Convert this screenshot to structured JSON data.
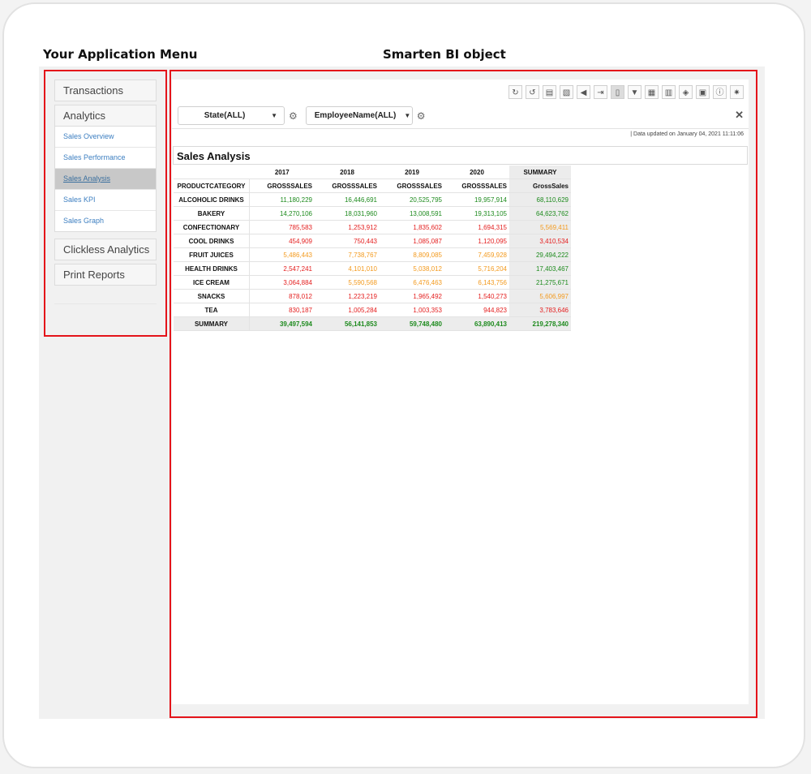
{
  "captions": {
    "menu": "Your Application Menu",
    "bi": "Smarten BI object"
  },
  "menu": {
    "transactions": "Transactions",
    "analytics": {
      "label": "Analytics",
      "items": [
        "Sales Overview",
        "Sales Performance",
        "Sales Analysis",
        "Sales KPI",
        "Sales Graph"
      ]
    },
    "clickless": "Clickless Analytics",
    "print": "Print Reports"
  },
  "toolbar_icons": [
    "refresh-icon",
    "reset-icon",
    "save-icon",
    "save-as-icon",
    "announce-icon",
    "export-icon",
    "new-doc-icon",
    "filter-icon",
    "calculator-icon",
    "grid-icon",
    "cube-icon",
    "print-icon",
    "info-icon",
    "settings-icon"
  ],
  "filters": {
    "state": "State(ALL)",
    "employee": "EmployeeName(ALL)"
  },
  "updated": "|  Data updated on January 04, 2021 11:11:06",
  "title": "Sales Analysis",
  "colors": {
    "green": "#1d8a1d",
    "red": "#e41e1e",
    "orange": "#f39a1e",
    "accent_red": "#e4141a"
  },
  "table": {
    "years": [
      "2017",
      "2018",
      "2019",
      "2020"
    ],
    "summary_label": "SUMMARY",
    "row_header": "PRODUCTCATEGORY",
    "measure": "GROSSSALES",
    "summary_measure": "GrossSales",
    "rows": [
      {
        "cat": "ALCOHOLIC DRINKS",
        "v": [
          "11,180,229",
          "16,446,691",
          "20,525,795",
          "19,957,914",
          "68,110,629"
        ],
        "c": [
          "green",
          "green",
          "green",
          "green",
          "green"
        ]
      },
      {
        "cat": "BAKERY",
        "v": [
          "14,270,106",
          "18,031,960",
          "13,008,591",
          "19,313,105",
          "64,623,762"
        ],
        "c": [
          "green",
          "green",
          "green",
          "green",
          "green"
        ]
      },
      {
        "cat": "CONFECTIONARY",
        "v": [
          "785,583",
          "1,253,912",
          "1,835,602",
          "1,694,315",
          "5,569,411"
        ],
        "c": [
          "red",
          "red",
          "red",
          "red",
          "orange"
        ]
      },
      {
        "cat": "COOL DRINKS",
        "v": [
          "454,909",
          "750,443",
          "1,085,087",
          "1,120,095",
          "3,410,534"
        ],
        "c": [
          "red",
          "red",
          "red",
          "red",
          "red"
        ]
      },
      {
        "cat": "FRUIT JUICES",
        "v": [
          "5,486,443",
          "7,738,767",
          "8,809,085",
          "7,459,928",
          "29,494,222"
        ],
        "c": [
          "orange",
          "orange",
          "orange",
          "orange",
          "green"
        ]
      },
      {
        "cat": "HEALTH DRINKS",
        "v": [
          "2,547,241",
          "4,101,010",
          "5,038,012",
          "5,716,204",
          "17,403,467"
        ],
        "c": [
          "red",
          "orange",
          "orange",
          "orange",
          "green"
        ]
      },
      {
        "cat": "ICE CREAM",
        "v": [
          "3,064,884",
          "5,590,568",
          "6,476,463",
          "6,143,756",
          "21,275,671"
        ],
        "c": [
          "red",
          "orange",
          "orange",
          "orange",
          "green"
        ]
      },
      {
        "cat": "SNACKS",
        "v": [
          "878,012",
          "1,223,219",
          "1,965,492",
          "1,540,273",
          "5,606,997"
        ],
        "c": [
          "red",
          "red",
          "red",
          "red",
          "orange"
        ]
      },
      {
        "cat": "TEA",
        "v": [
          "830,187",
          "1,005,284",
          "1,003,353",
          "944,823",
          "3,783,646"
        ],
        "c": [
          "red",
          "red",
          "red",
          "red",
          "red"
        ]
      }
    ],
    "summary_row": {
      "cat": "SUMMARY",
      "v": [
        "39,497,594",
        "56,141,853",
        "59,748,480",
        "63,890,413",
        "219,278,340"
      ]
    }
  }
}
